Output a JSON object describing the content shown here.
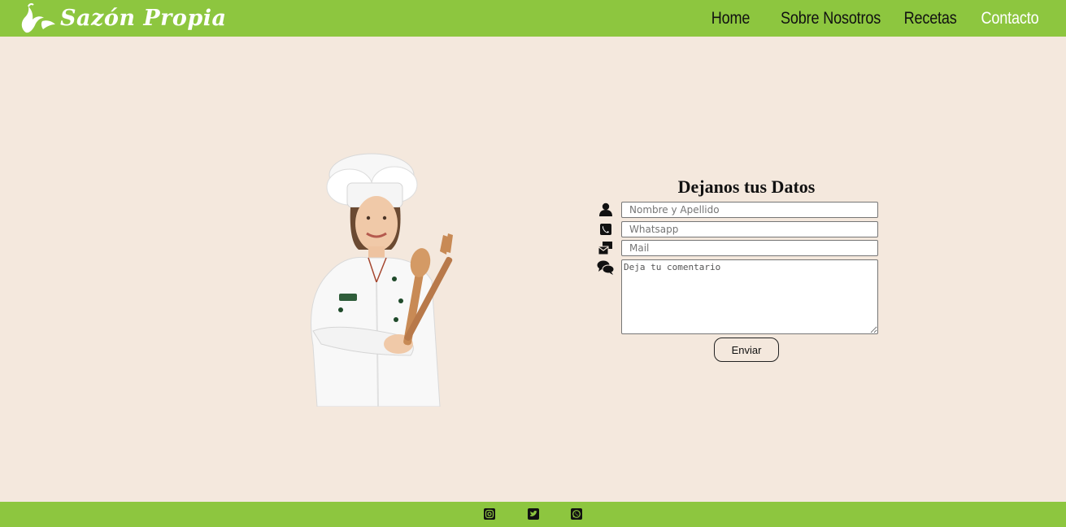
{
  "brand": {
    "name": "Sazón Propia",
    "logo_icon": "chili-pepper-icon"
  },
  "nav": {
    "items": [
      {
        "label": "Home",
        "active": false
      },
      {
        "label": "Sobre Nosotros",
        "active": false
      },
      {
        "label": "Recetas",
        "active": false
      },
      {
        "label": "Contacto",
        "active": true
      }
    ]
  },
  "contact_form": {
    "title": "Dejanos tus Datos",
    "name_placeholder": "Nombre y Apellido",
    "whatsapp_placeholder": "Whatsapp",
    "mail_placeholder": "Mail",
    "comment_placeholder": "Deja tu comentario",
    "submit_label": "Enviar"
  },
  "footer": {
    "social": [
      "instagram-icon",
      "twitter-icon",
      "whatsapp-icon"
    ]
  },
  "colors": {
    "bar": "#8dc63f",
    "background": "#f4e8dd",
    "active_nav": "#ffffff"
  }
}
